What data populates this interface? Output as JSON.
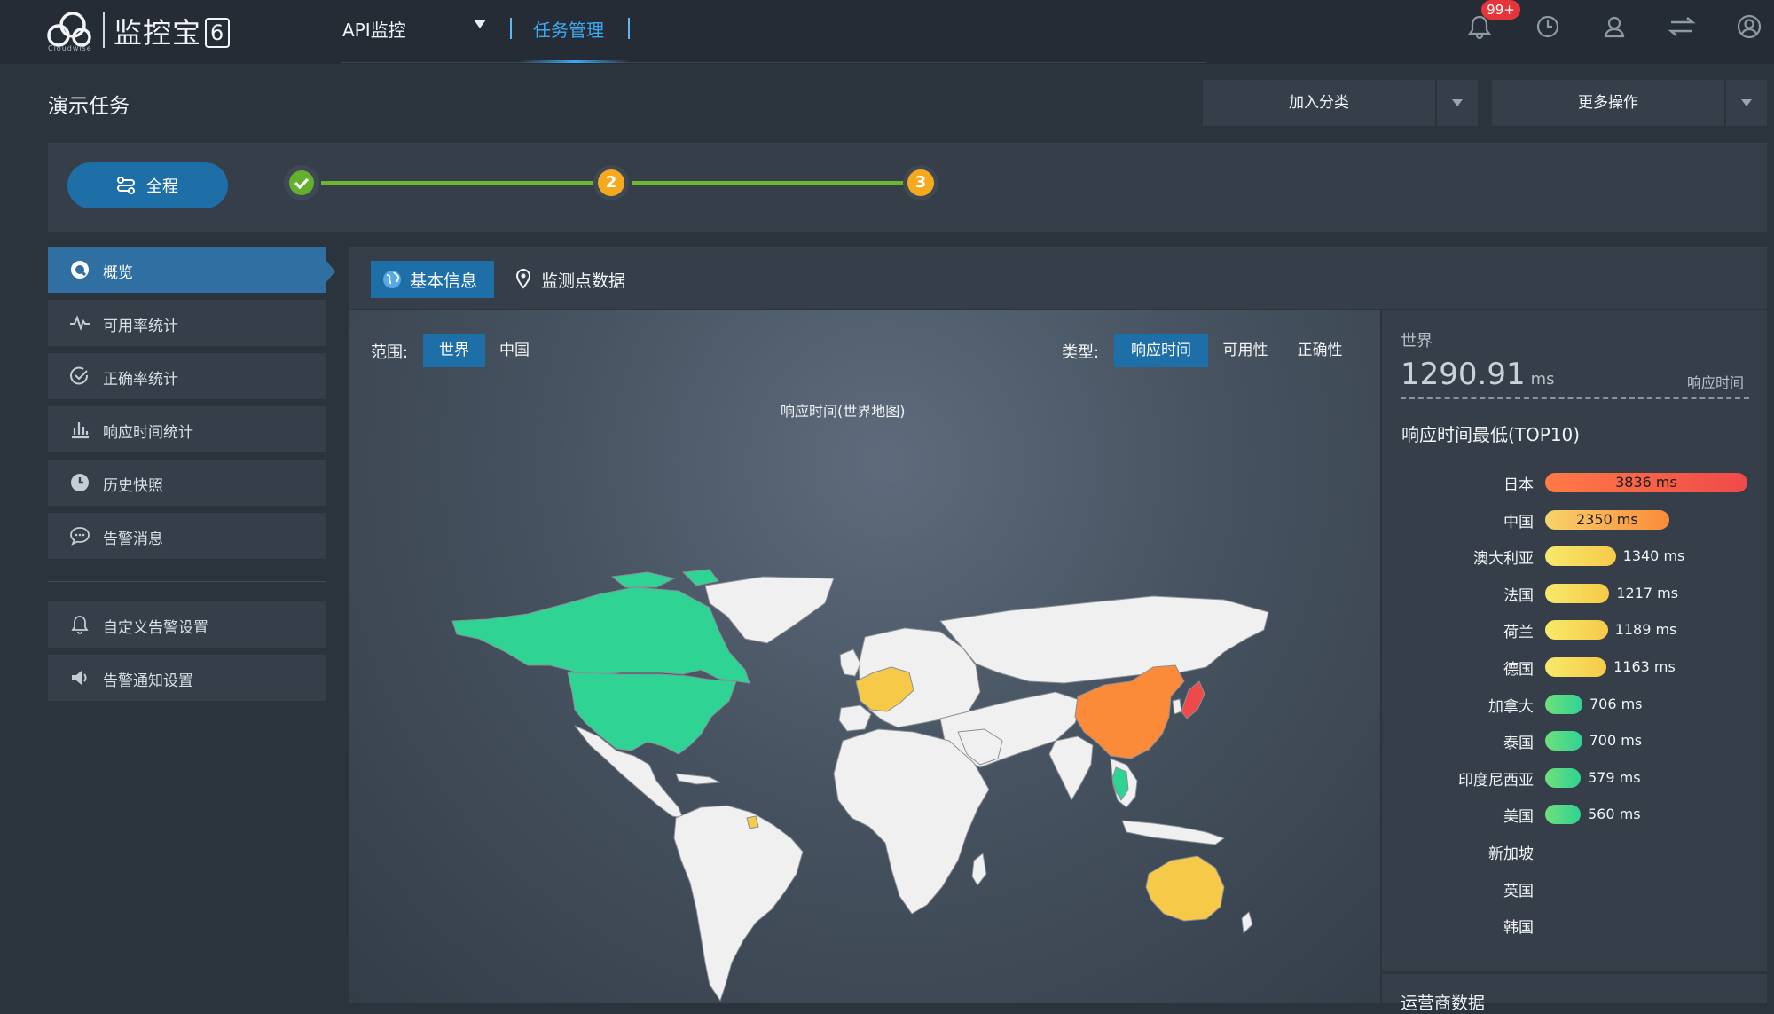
{
  "topbar": {
    "logo_text": "监控宝",
    "logo_version": "6",
    "logo_sub": "Cloudwise",
    "nav_api": "API监控",
    "nav_task": "任务管理",
    "notification_count": "99+"
  },
  "header": {
    "title": "演示任务",
    "add_category": "加入分类",
    "more_actions": "更多操作"
  },
  "progress": {
    "all_label": "全程",
    "steps": [
      "2",
      "3"
    ]
  },
  "sidebar": {
    "items": [
      {
        "label": "概览",
        "icon": "overview-icon"
      },
      {
        "label": "可用率统计",
        "icon": "pulse-icon"
      },
      {
        "label": "正确率统计",
        "icon": "check-circle-icon"
      },
      {
        "label": "响应时间统计",
        "icon": "bar-chart-icon"
      },
      {
        "label": "历史快照",
        "icon": "clock-icon"
      },
      {
        "label": "告警消息",
        "icon": "chat-icon"
      }
    ],
    "settings": [
      {
        "label": "自定义告警设置",
        "icon": "bell-icon"
      },
      {
        "label": "告警通知设置",
        "icon": "speaker-icon"
      }
    ]
  },
  "tabs": {
    "basic": "基本信息",
    "monitor": "监测点数据"
  },
  "filters": {
    "scope_label": "范围:",
    "scope_world": "世界",
    "scope_china": "中国",
    "type_label": "类型:",
    "type_response": "响应时间",
    "type_availability": "可用性",
    "type_correctness": "正确性"
  },
  "map": {
    "title": "响应时间(世界地图)",
    "colors": {
      "jp": "#ef4a4a",
      "cn": "#fb8a39",
      "high_yellow": "#f7c948",
      "green": "#2fd394",
      "none": "#f0f0f0"
    }
  },
  "summary": {
    "region": "世界",
    "value": "1290.91",
    "unit": "ms",
    "kind": "响应时间",
    "top10_title": "响应时间最低(TOP10)"
  },
  "ranking": [
    {
      "name": "日本",
      "value": 3836,
      "label": "3836 ms",
      "color": "red"
    },
    {
      "name": "中国",
      "value": 2350,
      "label": "2350 ms",
      "color": "orange"
    },
    {
      "name": "澳大利亚",
      "value": 1340,
      "label": "1340 ms",
      "color": "yellow"
    },
    {
      "name": "法国",
      "value": 1217,
      "label": "1217 ms",
      "color": "yellow"
    },
    {
      "name": "荷兰",
      "value": 1189,
      "label": "1189 ms",
      "color": "yellow"
    },
    {
      "name": "德国",
      "value": 1163,
      "label": "1163 ms",
      "color": "yellow"
    },
    {
      "name": "加拿大",
      "value": 706,
      "label": "706 ms",
      "color": "green"
    },
    {
      "name": "泰国",
      "value": 700,
      "label": "700 ms",
      "color": "green"
    },
    {
      "name": "印度尼西亚",
      "value": 579,
      "label": "579 ms",
      "color": "green"
    },
    {
      "name": "美国",
      "value": 560,
      "label": "560 ms",
      "color": "green"
    },
    {
      "name": "新加坡",
      "value": null,
      "label": "",
      "color": ""
    },
    {
      "name": "英国",
      "value": null,
      "label": "",
      "color": ""
    },
    {
      "name": "韩国",
      "value": null,
      "label": "",
      "color": ""
    }
  ],
  "operator_section": "运营商数据"
}
